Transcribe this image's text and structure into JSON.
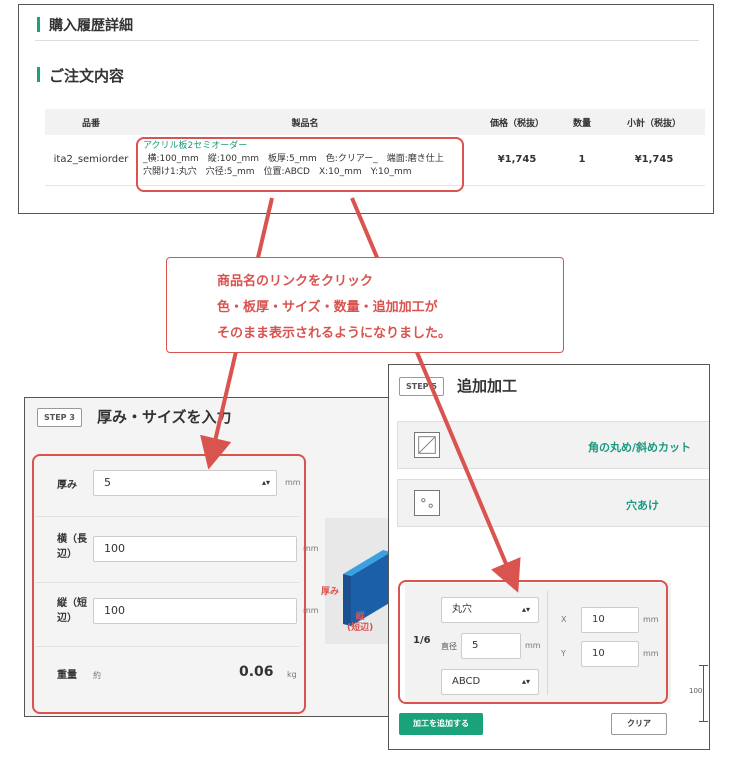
{
  "top": {
    "purchase_heading": "購入履歴詳細",
    "order_heading": "ご注文内容",
    "table": {
      "headers": [
        "品番",
        "製品名",
        "価格（税抜）",
        "数量",
        "小計（税抜）"
      ],
      "row": {
        "sku": "ita2_semiorder",
        "product_link": "アクリル板2セミオーダー",
        "spec_line1": "_横:100_mm　縦:100_mm　板厚:5_mm　色:クリアー_　端面:磨き仕上",
        "spec_line2": "穴開け1:丸穴　穴径:5_mm　位置:ABCD　X:10_mm　Y:10_mm",
        "price": "¥1,745",
        "qty": "1",
        "subtotal": "¥1,745"
      }
    }
  },
  "callout": {
    "line1": "商品名のリンクをクリック",
    "line2": "色・板厚・サイズ・数量・追加加工が",
    "line3": "そのまま表示されるようになりました。"
  },
  "step3": {
    "badge": "STEP 3",
    "title": "厚み・サイズを入力",
    "thickness_label": "厚み",
    "thickness_value": "5",
    "width_label_1": "横（長",
    "width_label_2": "辺）",
    "width_value": "100",
    "height_label_1": "縦（短",
    "height_label_2": "辺）",
    "height_value": "100",
    "unit_mm": "mm",
    "weight_label": "重量",
    "weight_prefix": "約",
    "weight_value": "0.06",
    "weight_unit": "kg",
    "diagram_label_thickness": "厚み",
    "diagram_label_short_1": "縦",
    "diagram_label_short_2": "(短辺)"
  },
  "step5": {
    "badge": "STEP 5",
    "title": "追加加工",
    "option_corner": "角の丸め/斜めカット",
    "option_hole": "穴あけ",
    "fraction": "1/6",
    "shape_select": "丸穴",
    "diameter_label": "直径",
    "diameter_value": "5",
    "unit_mm": "mm",
    "position_select": "ABCD",
    "x_label": "X",
    "x_value": "10",
    "y_label": "Y",
    "y_value": "10",
    "side_dim": "100",
    "add_button": "加工を追加する",
    "clear_button": "クリア"
  },
  "colors": {
    "accent": "#1aa37a",
    "link": "#1a9980",
    "highlight": "#d9534f"
  }
}
